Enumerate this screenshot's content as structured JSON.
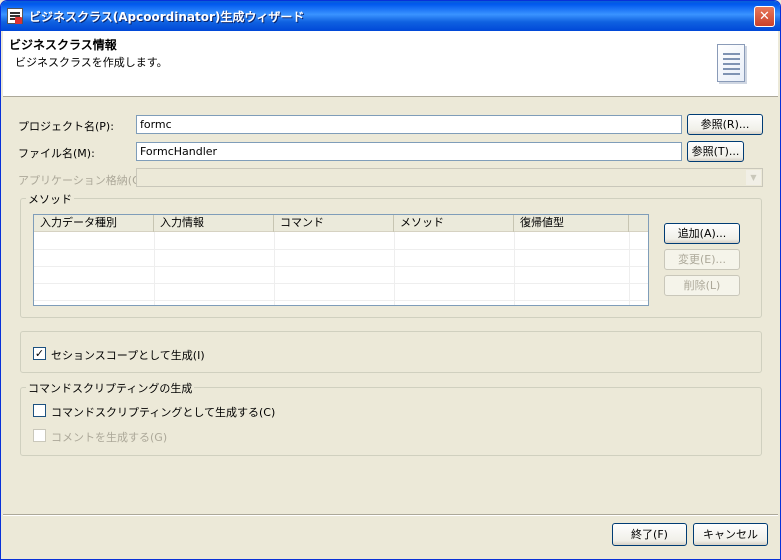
{
  "window": {
    "title": "ビジネスクラス(Apcoordinator)生成ウィザード",
    "close_glyph": "✕"
  },
  "header": {
    "title": "ビジネスクラス情報",
    "description": "ビジネスクラスを作成します。"
  },
  "fields": {
    "project_label": "プロジェクト名(P):",
    "project_value": "formc",
    "project_browse": "参照(R)...",
    "file_label": "ファイル名(M):",
    "file_value": "FormcHandler",
    "file_browse": "参照(T)...",
    "app_label": "アプリケーション格納(O):",
    "app_value": ""
  },
  "method_group": {
    "title": "メソッド",
    "columns": [
      "入力データ種別",
      "入力情報",
      "コマンド",
      "メソッド",
      "復帰値型"
    ],
    "rows": [],
    "add_button": "追加(A)...",
    "edit_button": "変更(E)...",
    "delete_button": "削除(L)"
  },
  "session_scope": {
    "label": "セションスコープとして生成(I)",
    "checked": true
  },
  "command_group": {
    "title": "コマンドスクリプティングの生成",
    "generate_label": "コマンドスクリプティングとして生成する(C)",
    "generate_checked": false,
    "comment_label": "コメントを生成する(G)",
    "comment_checked": false
  },
  "footer": {
    "finish_button": "終了(F)",
    "cancel_button": "キャンセル"
  },
  "colors": {
    "titlebar": "#0058ee",
    "dialog_bg": "#ece9d8",
    "input_border": "#7f9db9"
  }
}
